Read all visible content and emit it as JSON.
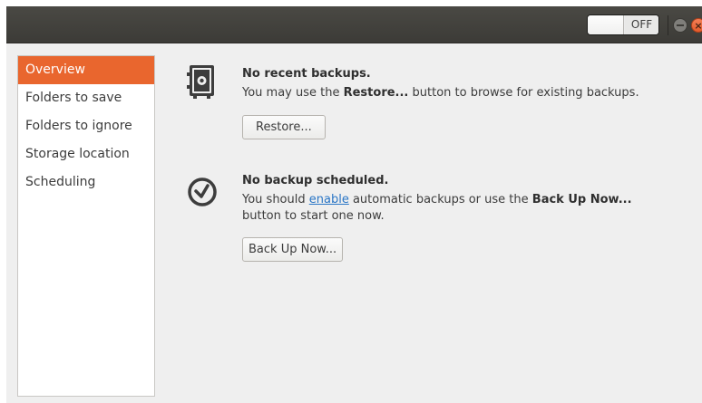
{
  "headerbar": {
    "switch_label": "OFF",
    "minimize_icon": "minimize-icon",
    "close_icon": "close-icon",
    "close_glyph": "×"
  },
  "sidebar": {
    "items": [
      {
        "label": "Overview",
        "active": true
      },
      {
        "label": "Folders to save",
        "active": false
      },
      {
        "label": "Folders to ignore",
        "active": false
      },
      {
        "label": "Storage location",
        "active": false
      },
      {
        "label": "Scheduling",
        "active": false
      }
    ]
  },
  "backups": {
    "icon": "safe-icon",
    "title": "No recent backups.",
    "text_before": "You may use the ",
    "text_bold": "Restore...",
    "text_after": " button to browse for existing backups.",
    "button_label": "Restore..."
  },
  "schedule": {
    "icon": "clock-icon",
    "title": "No backup scheduled.",
    "text_before": "You should ",
    "link_text": "enable",
    "text_middle": " automatic backups or use the ",
    "text_bold": "Back Up Now...",
    "text_line2": "button to start one now.",
    "button_label": "Back Up Now..."
  },
  "colors": {
    "accent": "#e9662e",
    "link": "#2a76c6",
    "headerbar": "#3c3b37"
  }
}
